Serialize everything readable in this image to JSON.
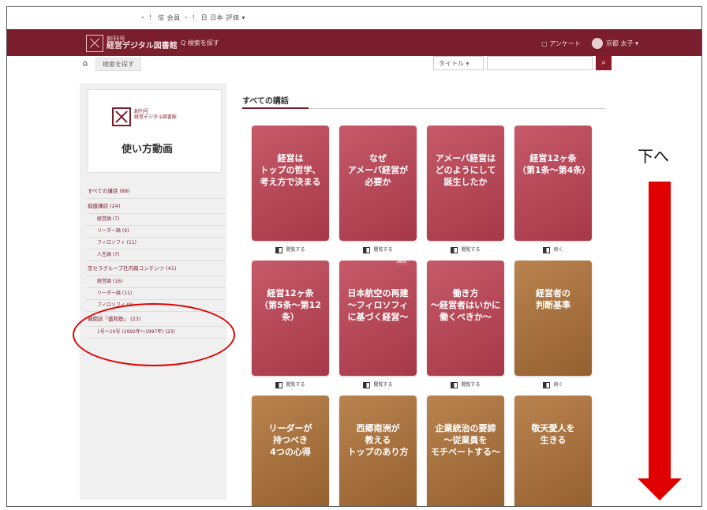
{
  "browser": {
    "links": "・ ！ 信 会員 ・ ！ 日 日本 評価 ▾"
  },
  "header": {
    "brand_small": "創刊号",
    "brand_name": "経営デジタル図書館",
    "search_link": "Q 検索を探す",
    "survey": "アンケート",
    "user": "京都 太子 ▾"
  },
  "breadcrumb": {
    "home_icon": "home-icon",
    "current": "検索を探す"
  },
  "search": {
    "select_value": "タイトル ▾",
    "button_icon": "search-icon"
  },
  "sidebar": {
    "promo_small": "創刊号\n経営デジタル図書館",
    "promo_title": "使い方動画",
    "categories": [
      {
        "label": "すべての講話 (88)",
        "sub": false
      },
      {
        "label": "稲盛講話 (24)",
        "sub": false
      },
      {
        "label": "経営論 (7)",
        "sub": true
      },
      {
        "label": "リーダー論 (9)",
        "sub": true
      },
      {
        "label": "フィロソフィ (11)",
        "sub": true
      },
      {
        "label": "人生論 (7)",
        "sub": true
      },
      {
        "label": "京セラグループ社内報コンテンツ (41)",
        "sub": false
      },
      {
        "label": "経営論 (16)",
        "sub": true
      },
      {
        "label": "リーダー論 (11)",
        "sub": true
      },
      {
        "label": "フィロソフィ (8)",
        "sub": true
      },
      {
        "label": "機関誌「盛和塾」 (23)",
        "sub": false
      },
      {
        "label": "1号〜10号 (1992年〜1997年) (23)",
        "sub": true
      }
    ]
  },
  "main": {
    "title": "すべての講話",
    "cards": [
      {
        "title": "経営は\nトップの哲学、\n考え方で決まる",
        "color": "red",
        "action": "閲覧する"
      },
      {
        "title": "なぜ\nアメーバ経営が\n必要か",
        "color": "red",
        "action": "閲覧する"
      },
      {
        "title": "アメーバ経営は\nどのようにして\n誕生したか",
        "color": "red",
        "action": "閲覧する"
      },
      {
        "title": "経営12ヶ条\n（第1条〜第4条）",
        "color": "red",
        "action": "続く"
      },
      {
        "title": "経営12ヶ条\n（第5条〜第12条）",
        "color": "red",
        "action": "閲覧する"
      },
      {
        "title": "日本航空の再建\n〜フィロソフィ\nに基づく経営〜",
        "color": "red",
        "action": "閲覧する",
        "badge": "NEW"
      },
      {
        "title": "働き方\n〜経営者はいかに\n働くべきか〜",
        "color": "red",
        "action": "閲覧する"
      },
      {
        "title": "経営者の\n判断基準",
        "color": "brown",
        "action": "続く"
      },
      {
        "title": "リーダーが\n持つべき\n4つの心得",
        "color": "brown",
        "action": ""
      },
      {
        "title": "西郷南洲が\n教える\nトップのあり方",
        "color": "brown",
        "action": ""
      },
      {
        "title": "企業統治の要諦\n〜従業員を\nモチベートする〜",
        "color": "brown",
        "action": ""
      },
      {
        "title": "敬天愛人を\n生きる",
        "color": "brown",
        "action": ""
      }
    ]
  },
  "annotation": {
    "text": "下へ",
    "arrow_color": "#e00000"
  }
}
